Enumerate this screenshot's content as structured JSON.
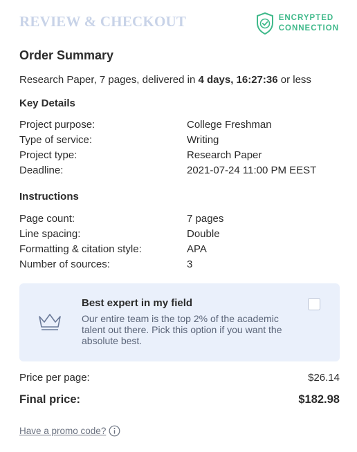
{
  "header": {
    "title": "REVIEW & CHECKOUT",
    "badge_line1": "ENCRYPTED",
    "badge_line2": "CONNECTION",
    "badge_icon": "shield-check-icon",
    "accent_color": "#3fb98a",
    "title_color": "#c8d3e8"
  },
  "summary": {
    "title": "Order Summary",
    "line_prefix": "Research Paper, 7 pages, delivered in ",
    "line_bold": "4 days, 16:27:36",
    "line_suffix": " or less"
  },
  "key_details": {
    "title": "Key Details",
    "rows": [
      {
        "label": "Project purpose:",
        "value": "College Freshman"
      },
      {
        "label": "Type of service:",
        "value": "Writing"
      },
      {
        "label": "Project type:",
        "value": "Research Paper"
      },
      {
        "label": "Deadline:",
        "value": "2021-07-24 11:00 PM EEST"
      }
    ]
  },
  "instructions": {
    "title": "Instructions",
    "rows": [
      {
        "label": "Page count:",
        "value": "7 pages"
      },
      {
        "label": "Line spacing:",
        "value": "Double"
      },
      {
        "label": "Formatting & citation style:",
        "value": "APA"
      },
      {
        "label": "Number of sources:",
        "value": "3"
      }
    ]
  },
  "expert_option": {
    "icon": "crown-icon",
    "title": "Best expert in my field",
    "description": "Our entire team is the top 2% of the academic talent out there. Pick this option if you want the absolute best.",
    "checked": false,
    "background": "#eaf0fb"
  },
  "pricing": {
    "price_per_page_label": "Price per page:",
    "price_per_page_value": "$26.14",
    "final_price_label": "Final price:",
    "final_price_value": "$182.98"
  },
  "promo": {
    "link_text": "Have a promo code?",
    "icon": "info-icon"
  }
}
